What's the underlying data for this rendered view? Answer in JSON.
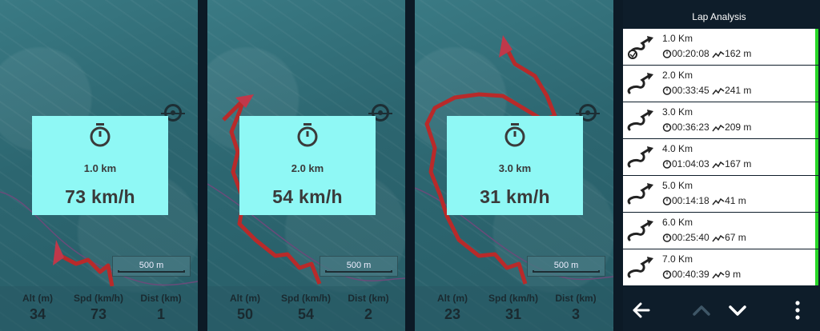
{
  "panels": [
    {
      "dist": "1.0 km",
      "speed": "73 km/h",
      "scale": "500 m",
      "alt_label": "Alt (m)",
      "alt": "34",
      "spd_label": "Spd (km/h)",
      "spd": "73",
      "dist_label": "Dist (km)",
      "dist_km": "1"
    },
    {
      "dist": "2.0 km",
      "speed": "54 km/h",
      "scale": "500 m",
      "alt_label": "Alt (m)",
      "alt": "50",
      "spd_label": "Spd (km/h)",
      "spd": "54",
      "dist_label": "Dist (km)",
      "dist_km": "2"
    },
    {
      "dist": "3.0 km",
      "speed": "31 km/h",
      "scale": "500 m",
      "alt_label": "Alt (m)",
      "alt": "23",
      "spd_label": "Spd (km/h)",
      "spd": "31",
      "dist_label": "Dist (km)",
      "dist_km": "3"
    }
  ],
  "lap": {
    "title": "Lap Analysis",
    "rows": [
      {
        "km": "1.0 Km",
        "time": "00:20:08",
        "elev": "162 m"
      },
      {
        "km": "2.0 Km",
        "time": "00:33:45",
        "elev": "241 m"
      },
      {
        "km": "3.0 Km",
        "time": "00:36:23",
        "elev": "209 m"
      },
      {
        "km": "4.0 Km",
        "time": "01:04:03",
        "elev": "167 m"
      },
      {
        "km": "5.0 Km",
        "time": "00:14:18",
        "elev": "41 m"
      },
      {
        "km": "6.0 Km",
        "time": "00:25:40",
        "elev": "67 m"
      },
      {
        "km": "7.0 Km",
        "time": "00:40:39",
        "elev": "9 m"
      }
    ],
    "accent": "#27d727"
  },
  "icons": {
    "panel": "stopwatch-icon",
    "row": "route-icon",
    "time": "timer-icon",
    "elev": "elevation-icon",
    "back": "back-arrow-icon",
    "up": "chevron-up-icon",
    "down": "chevron-down-icon",
    "menu": "more-vert-icon"
  }
}
